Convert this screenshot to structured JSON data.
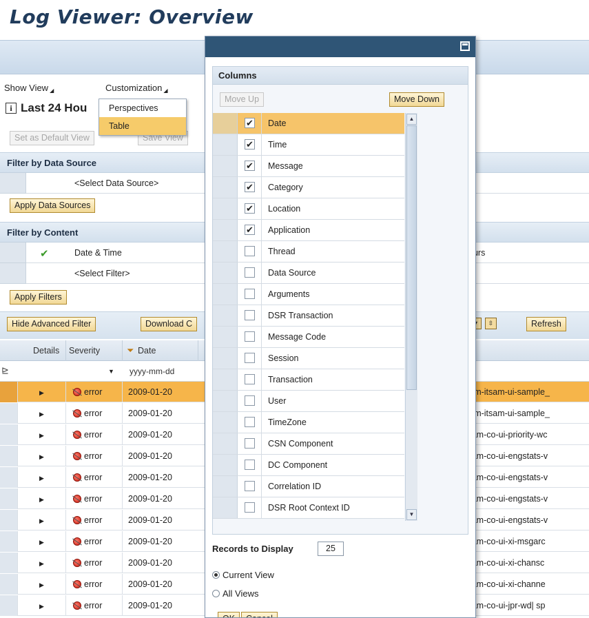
{
  "page": {
    "title": "Log Viewer: Overview",
    "menus": {
      "show_view": "Show View",
      "customization": "Customization"
    },
    "customization_menu": [
      "Perspectives",
      "Table"
    ],
    "view_title": "Last 24 Hou",
    "info_icon": "i",
    "buttons": {
      "set_default": "Set as Default View",
      "save_view": "Save View",
      "apply_data_sources": "Apply Data Sources",
      "apply_filters": "Apply Filters",
      "hide_advanced": "Hide Advanced Filter",
      "download": "Download C",
      "refresh": "Refresh"
    },
    "filter_data_source": {
      "heading": "Filter by Data Source",
      "placeholder": "<Select Data Source>"
    },
    "filter_content": {
      "heading": "Filter by Content",
      "date_time": "Date & Time",
      "date_time_value": "ours",
      "select_filter": "<Select Filter>"
    }
  },
  "grid": {
    "headers": {
      "details": "Details",
      "severity": "Severity",
      "date": "Date"
    },
    "date_filter_placeholder": "yyyy-mm-dd",
    "rows": [
      {
        "severity": "error",
        "date": "2009-01-20",
        "tail": "v-lm-itsam-ui-sample_"
      },
      {
        "severity": "error",
        "date": "2009-01-20",
        "tail": "v-lm-itsam-ui-sample_"
      },
      {
        "severity": "error",
        "date": "2009-01-20",
        "tail": "tsam-co-ui-priority-wc"
      },
      {
        "severity": "error",
        "date": "2009-01-20",
        "tail": "tsam-co-ui-engstats-v"
      },
      {
        "severity": "error",
        "date": "2009-01-20",
        "tail": "tsam-co-ui-engstats-v"
      },
      {
        "severity": "error",
        "date": "2009-01-20",
        "tail": "tsam-co-ui-engstats-v"
      },
      {
        "severity": "error",
        "date": "2009-01-20",
        "tail": "tsam-co-ui-engstats-v"
      },
      {
        "severity": "error",
        "date": "2009-01-20",
        "tail": "tsam-co-ui-xi-msgarc"
      },
      {
        "severity": "error",
        "date": "2009-01-20",
        "tail": "tsam-co-ui-xi-chansc"
      },
      {
        "severity": "error",
        "date": "2009-01-20",
        "tail": "tsam-co-ui-xi-channe"
      },
      {
        "severity": "error",
        "date": "2009-01-20",
        "tail": "tsam-co-ui-jpr-wd| sp"
      }
    ]
  },
  "popup": {
    "columns_heading": "Columns",
    "move_up": "Move Up",
    "move_down": "Move Down",
    "columns": [
      {
        "label": "Date",
        "checked": "✔"
      },
      {
        "label": "Time",
        "checked": "✔"
      },
      {
        "label": "Message",
        "checked": "✔"
      },
      {
        "label": "Category",
        "checked": "✔"
      },
      {
        "label": "Location",
        "checked": "✔"
      },
      {
        "label": "Application",
        "checked": "✔"
      },
      {
        "label": "Thread",
        "checked": ""
      },
      {
        "label": "Data Source",
        "checked": ""
      },
      {
        "label": "Arguments",
        "checked": ""
      },
      {
        "label": "DSR Transaction",
        "checked": ""
      },
      {
        "label": "Message Code",
        "checked": ""
      },
      {
        "label": "Session",
        "checked": ""
      },
      {
        "label": "Transaction",
        "checked": ""
      },
      {
        "label": "User",
        "checked": ""
      },
      {
        "label": "TimeZone",
        "checked": ""
      },
      {
        "label": "CSN Component",
        "checked": ""
      },
      {
        "label": "DC Component",
        "checked": ""
      },
      {
        "label": "Correlation ID",
        "checked": ""
      },
      {
        "label": "DSR Root Context ID",
        "checked": ""
      }
    ],
    "records_label": "Records to Display",
    "records_value": "25",
    "scope_current": "Current View",
    "scope_all": "All Views",
    "ok": "OK",
    "cancel": "Cancel"
  },
  "colors": {
    "accent_orange": "#f6b54a",
    "titlebar": "#2f5576",
    "title_text": "#213c5c"
  }
}
